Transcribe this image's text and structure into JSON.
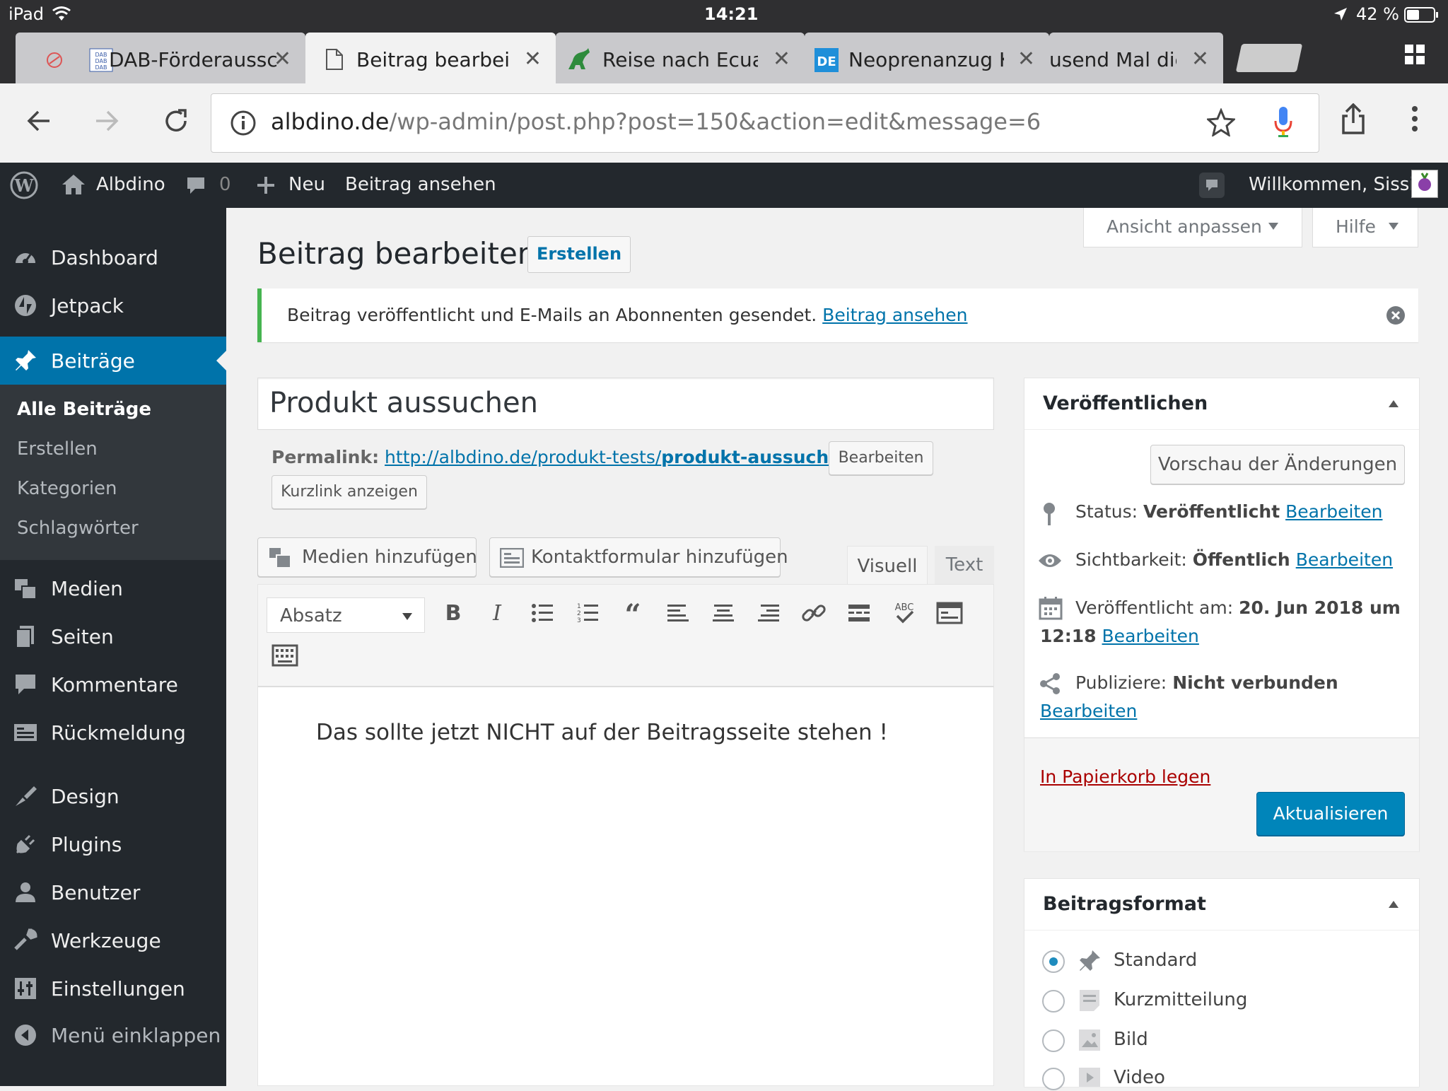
{
  "status_bar": {
    "device": "iPad",
    "time": "14:21",
    "battery": "42 %"
  },
  "browser": {
    "tabs": [
      {
        "title": "DAB-Förderaussc",
        "favicon": "dab-icon",
        "active": false
      },
      {
        "title": "Beitrag bearbeite",
        "favicon": "document-icon",
        "active": true
      },
      {
        "title": "Reise nach Ecuad",
        "favicon": "dino-icon",
        "active": false
      },
      {
        "title": "Neoprenanzug Ka",
        "favicon": "de-icon",
        "active": false
      },
      {
        "title": "usend Mal dies",
        "favicon": "",
        "active": false
      }
    ],
    "url_domain": "albdino.de",
    "url_path": "/wp-admin/post.php?post=150&action=edit&message=6"
  },
  "admin_bar": {
    "site_name": "Albdino",
    "comments_count": "0",
    "new_label": "Neu",
    "view_post": "Beitrag ansehen",
    "welcome": "Willkommen, Sissi"
  },
  "sidebar": {
    "items": [
      {
        "label": "Dashboard",
        "icon": "dashboard-icon"
      },
      {
        "label": "Jetpack",
        "icon": "jetpack-icon"
      },
      {
        "label": "Beiträge",
        "icon": "pin-icon"
      },
      {
        "label": "Medien",
        "icon": "media-icon"
      },
      {
        "label": "Seiten",
        "icon": "pages-icon"
      },
      {
        "label": "Kommentare",
        "icon": "comment-icon"
      },
      {
        "label": "Rückmeldung",
        "icon": "feedback-icon"
      },
      {
        "label": "Design",
        "icon": "brush-icon"
      },
      {
        "label": "Plugins",
        "icon": "plugin-icon"
      },
      {
        "label": "Benutzer",
        "icon": "user-icon"
      },
      {
        "label": "Werkzeuge",
        "icon": "wrench-icon"
      },
      {
        "label": "Einstellungen",
        "icon": "settings-icon"
      },
      {
        "label": "Menü einklappen",
        "icon": "collapse-icon"
      }
    ],
    "submenu": [
      "Alle Beiträge",
      "Erstellen",
      "Kategorien",
      "Schlagwörter"
    ]
  },
  "screen_options": "Ansicht anpassen",
  "help": "Hilfe",
  "page_title": "Beitrag bearbeiten",
  "add_new": "Erstellen",
  "notice": {
    "text": "Beitrag veröffentlicht und E-Mails an Abonnenten gesendet.",
    "link": "Beitrag ansehen"
  },
  "post_title": "Produkt aussuchen",
  "permalink": {
    "label": "Permalink:",
    "url_base": "http://albdino.de/produkt-tests/",
    "slug": "produkt-aussuchen/",
    "edit": "Bearbeiten",
    "shortlink": "Kurzlink anzeigen"
  },
  "media_buttons": {
    "add_media": "Medien hinzufügen",
    "add_contact": "Kontaktformular hinzufügen"
  },
  "editor_tabs": {
    "visual": "Visuell",
    "text": "Text"
  },
  "format_select": "Absatz",
  "content": "Das sollte jetzt NICHT auf der Beitragsseite stehen !",
  "publish_box": {
    "title": "Veröffentlichen",
    "preview": "Vorschau der Änderungen",
    "status_label": "Status:",
    "status_value": "Veröffentlicht",
    "visibility_label": "Sichtbarkeit:",
    "visibility_value": "Öffentlich",
    "published_label": "Veröffentlicht am:",
    "published_value_a": "20. Jun 2018 um",
    "published_value_b": "12:18",
    "publicize_label": "Publiziere:",
    "publicize_value": "Nicht verbunden",
    "edit": "Bearbeiten",
    "trash": "In Papierkorb legen",
    "update": "Aktualisieren"
  },
  "format_box": {
    "title": "Beitragsformat",
    "options": [
      "Standard",
      "Kurzmitteilung",
      "Bild",
      "Video"
    ],
    "selected": "Standard"
  },
  "colors": {
    "wp_blue": "#0073aa",
    "admin_dark": "#23282d",
    "notice_green": "#46b450",
    "trash_red": "#a00"
  }
}
